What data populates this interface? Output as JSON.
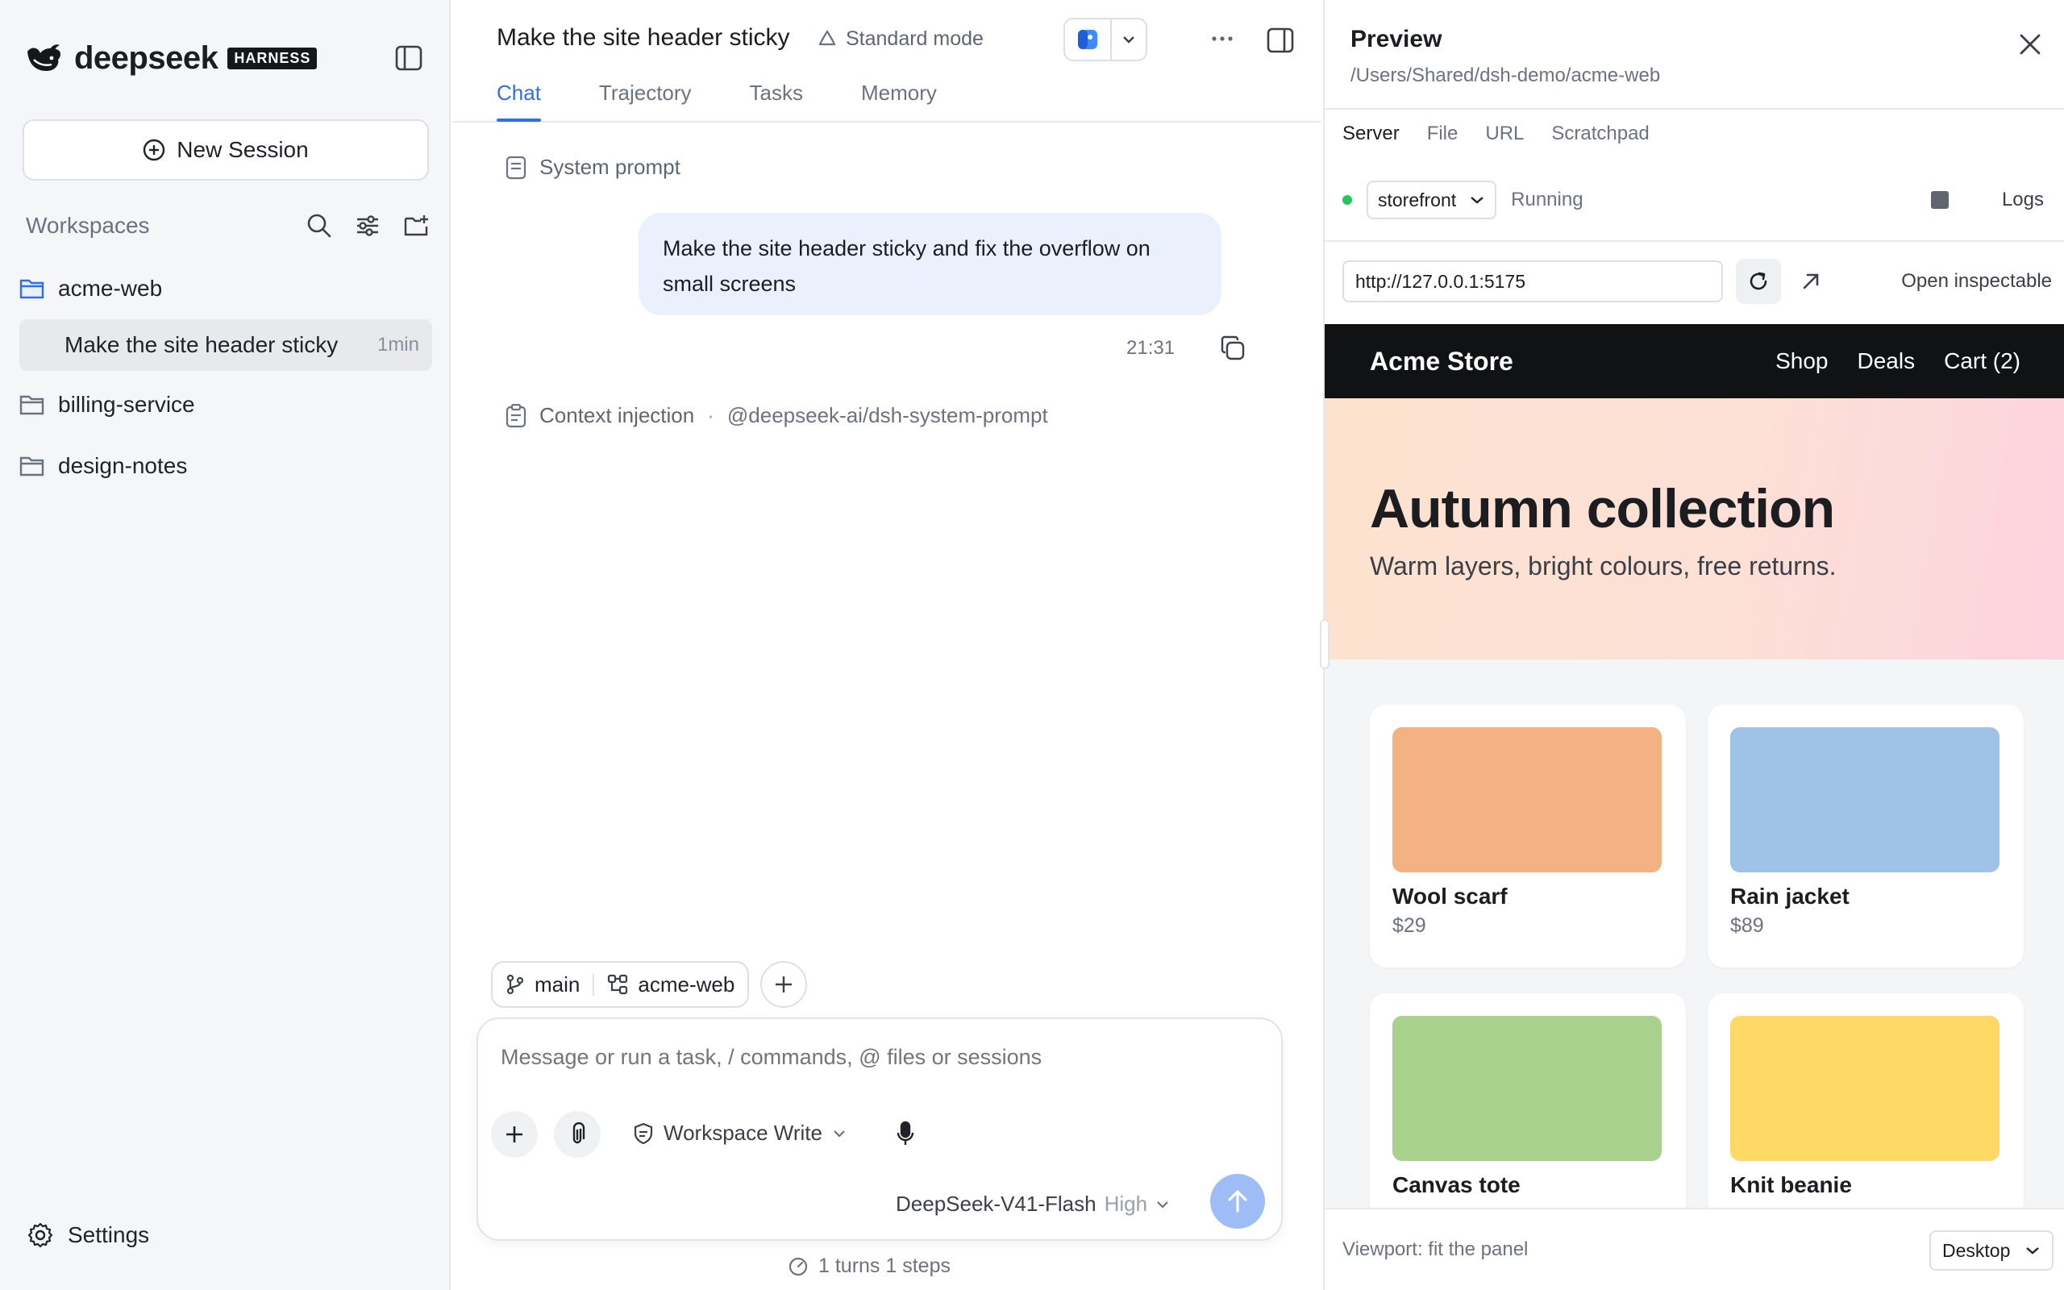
{
  "sidebar": {
    "brand": "deepseek",
    "badge": "HARNESS",
    "new_session_label": "New Session",
    "workspaces_label": "Workspaces",
    "workspaces": [
      {
        "name": "acme-web",
        "expanded": true
      },
      {
        "name": "billing-service"
      },
      {
        "name": "design-notes"
      }
    ],
    "active_session": {
      "title": "Make the site header sticky",
      "age": "1min"
    },
    "settings_label": "Settings"
  },
  "session": {
    "title": "Make the site header sticky",
    "mode": "Standard mode",
    "tabs": [
      "Chat",
      "Trajectory",
      "Tasks",
      "Memory"
    ],
    "active_tab": "Chat"
  },
  "chat": {
    "system_prompt_label": "System prompt",
    "user_message": "Make the site header sticky and fix the overflow on small screens",
    "message_time": "21:31",
    "context_label": "Context injection",
    "context_separator": "·",
    "context_ref": "@deepseek-ai/dsh-system-prompt"
  },
  "composer": {
    "branch": "main",
    "workspace": "acme-web",
    "placeholder": "Message or run a task, / commands, @ files or sessions",
    "permission": "Workspace Write",
    "model": "DeepSeek-V41-Flash",
    "effort": "High",
    "turns_summary": "1 turns 1 steps"
  },
  "preview": {
    "title": "Preview",
    "path": "/Users/Shared/dsh-demo/acme-web",
    "tabs": [
      "Server",
      "File",
      "URL",
      "Scratchpad"
    ],
    "active_tab": "Server",
    "server_name": "storefront",
    "server_status": "Running",
    "logs_label": "Logs",
    "url": "http://127.0.0.1:5175",
    "open_inspectable_label": "Open inspectable",
    "viewport_label": "Viewport: fit the panel",
    "viewport_option": "Desktop",
    "site": {
      "brand": "Acme Store",
      "nav": [
        "Shop",
        "Deals",
        "Cart (2)"
      ],
      "hero_title": "Autumn collection",
      "hero_subtitle": "Warm layers, bright colours, free returns.",
      "products": [
        {
          "name": "Wool scarf",
          "price": "$29",
          "color": "#f4b183"
        },
        {
          "name": "Rain jacket",
          "price": "$89",
          "color": "#9fc3e7"
        },
        {
          "name": "Canvas tote",
          "price": "",
          "color": "#a9d18e"
        },
        {
          "name": "Knit beanie",
          "price": "",
          "color": "#ffd966"
        }
      ]
    }
  },
  "colors": {
    "accent": "#2f6fed",
    "user_bubble": "#eaf1fd",
    "status_running": "#22c55e",
    "send_disabled": "#9ebcf5"
  }
}
